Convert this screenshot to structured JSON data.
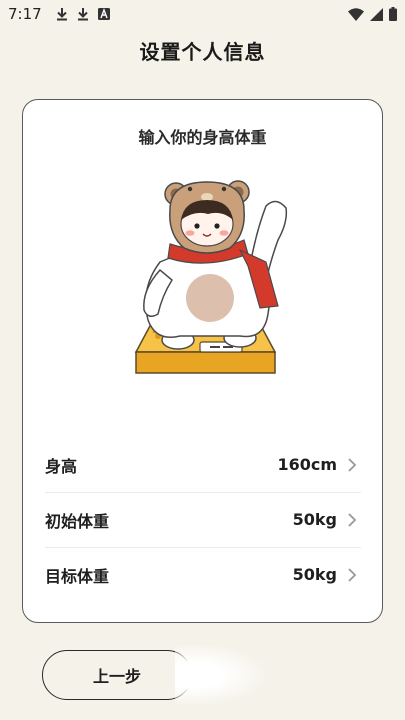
{
  "status_bar": {
    "time": "7:17",
    "left_icons": [
      "download-icon",
      "download-icon",
      "a-letter-icon"
    ],
    "right_icons": [
      "wifi-icon",
      "signal-icon",
      "battery-icon"
    ]
  },
  "page": {
    "title": "设置个人信息"
  },
  "card": {
    "title": "输入你的身高体重",
    "illustration": "bear-costume-girl-on-scale",
    "rows": [
      {
        "label": "身高",
        "value": "160cm"
      },
      {
        "label": "初始体重",
        "value": "50kg"
      },
      {
        "label": "目标体重",
        "value": "50kg"
      }
    ]
  },
  "buttons": {
    "prev_label": "上一步"
  },
  "colors": {
    "background": "#f5f2e9",
    "card": "#ffffff",
    "scarf": "#d33a2c",
    "scale": "#f2b533"
  }
}
